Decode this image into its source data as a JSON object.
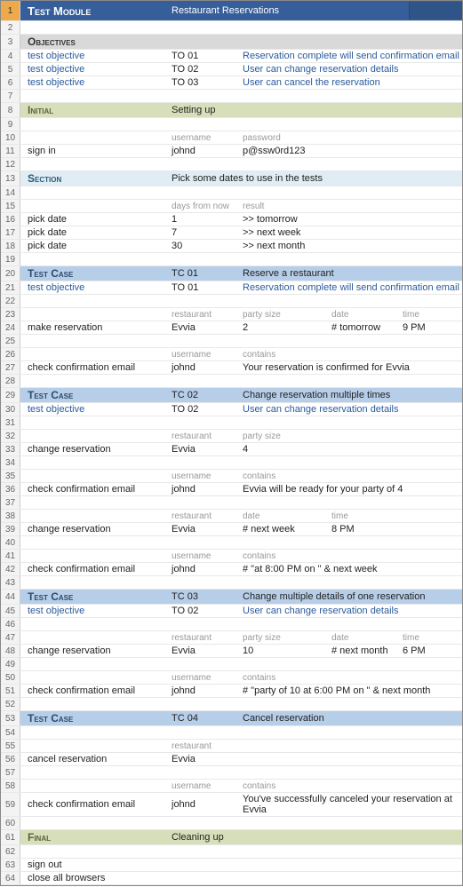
{
  "rows": [
    {
      "n": 1,
      "sel": true,
      "cls": "module",
      "A": "Test Module",
      "B": "Restaurant Reservations"
    },
    {
      "n": 2
    },
    {
      "n": 3,
      "cls": "band-grey",
      "A": "Objectives"
    },
    {
      "n": 4,
      "A": "test objective",
      "Acls": "link",
      "B": "TO 01",
      "C": "Reservation complete will send confirmation email",
      "Ccls": "link",
      "Cspan": 3
    },
    {
      "n": 5,
      "A": "test objective",
      "Acls": "link",
      "B": "TO 02",
      "C": "User can change reservation details",
      "Ccls": "link",
      "Cspan": 3
    },
    {
      "n": 6,
      "A": "test objective",
      "Acls": "link",
      "B": "TO 03",
      "C": "User can cancel the reservation",
      "Ccls": "link",
      "Cspan": 3
    },
    {
      "n": 7
    },
    {
      "n": 8,
      "cls": "band-olive",
      "A": "Initial",
      "B": "Setting up"
    },
    {
      "n": 9
    },
    {
      "n": 10,
      "B": "username",
      "Bcls": "hdr",
      "C": "password",
      "Ccls": "hdr"
    },
    {
      "n": 11,
      "A": "sign in",
      "B": "johnd",
      "C": "p@ssw0rd123"
    },
    {
      "n": 12
    },
    {
      "n": 13,
      "cls": "band-lightblue",
      "A": "Section",
      "B": "Pick some dates to use in the tests",
      "Bspan": 4
    },
    {
      "n": 14
    },
    {
      "n": 15,
      "B": "days from now",
      "Bcls": "hdr",
      "C": "result",
      "Ccls": "hdr"
    },
    {
      "n": 16,
      "A": "pick date",
      "B": "1",
      "C": ">> tomorrow"
    },
    {
      "n": 17,
      "A": "pick date",
      "B": "7",
      "C": ">> next week"
    },
    {
      "n": 18,
      "A": "pick date",
      "B": "30",
      "C": ">> next month"
    },
    {
      "n": 19
    },
    {
      "n": 20,
      "cls": "band-blue",
      "A": "Test Case",
      "B": "TC 01",
      "C": "Reserve a restaurant",
      "Cspan": 3
    },
    {
      "n": 21,
      "A": "test objective",
      "Acls": "link",
      "B": "TO 01",
      "C": "Reservation complete will send confirmation email",
      "Ccls": "link",
      "Cspan": 3
    },
    {
      "n": 22
    },
    {
      "n": 23,
      "B": "restaurant",
      "Bcls": "hdr",
      "C": "party size",
      "Ccls": "hdr",
      "D": "date",
      "Dcls": "hdr",
      "E": "time",
      "Ecls": "hdr"
    },
    {
      "n": 24,
      "A": "make reservation",
      "B": "Evvia",
      "C": "2",
      "D": "# tomorrow",
      "E": "9 PM"
    },
    {
      "n": 25
    },
    {
      "n": 26,
      "B": "username",
      "Bcls": "hdr",
      "C": "contains",
      "Ccls": "hdr"
    },
    {
      "n": 27,
      "A": "check confirmation email",
      "B": "johnd",
      "C": "Your reservation is confirmed for Evvia",
      "Cspan": 3
    },
    {
      "n": 28
    },
    {
      "n": 29,
      "cls": "band-blue",
      "A": "Test Case",
      "B": "TC 02",
      "C": "Change reservation multiple times",
      "Cspan": 3
    },
    {
      "n": 30,
      "A": "test objective",
      "Acls": "link",
      "B": "TO 02",
      "C": "User can change reservation details",
      "Ccls": "link",
      "Cspan": 3
    },
    {
      "n": 31
    },
    {
      "n": 32,
      "B": "restaurant",
      "Bcls": "hdr",
      "C": "party size",
      "Ccls": "hdr"
    },
    {
      "n": 33,
      "A": "change reservation",
      "B": "Evvia",
      "C": "4"
    },
    {
      "n": 34
    },
    {
      "n": 35,
      "B": "username",
      "Bcls": "hdr",
      "C": "contains",
      "Ccls": "hdr"
    },
    {
      "n": 36,
      "A": "check confirmation email",
      "B": "johnd",
      "C": "Evvia will be ready for your party of 4",
      "Cspan": 3
    },
    {
      "n": 37
    },
    {
      "n": 38,
      "B": "restaurant",
      "Bcls": "hdr",
      "C": "date",
      "Ccls": "hdr",
      "D": "time",
      "Dcls": "hdr"
    },
    {
      "n": 39,
      "A": "change reservation",
      "B": "Evvia",
      "C": "# next week",
      "D": "8 PM"
    },
    {
      "n": 40
    },
    {
      "n": 41,
      "B": "username",
      "Bcls": "hdr",
      "C": "contains",
      "Ccls": "hdr"
    },
    {
      "n": 42,
      "A": "check confirmation email",
      "B": "johnd",
      "C": "# \"at 8:00 PM on \" & next week",
      "Cspan": 3
    },
    {
      "n": 43
    },
    {
      "n": 44,
      "cls": "band-blue",
      "A": "Test Case",
      "B": "TC 03",
      "C": "Change multiple details of one reservation",
      "Cspan": 3
    },
    {
      "n": 45,
      "A": "test objective",
      "Acls": "link",
      "B": "TO 02",
      "C": "User can change reservation details",
      "Ccls": "link",
      "Cspan": 3
    },
    {
      "n": 46
    },
    {
      "n": 47,
      "B": "restaurant",
      "Bcls": "hdr",
      "C": "party size",
      "Ccls": "hdr",
      "D": "date",
      "Dcls": "hdr",
      "E": "time",
      "Ecls": "hdr"
    },
    {
      "n": 48,
      "A": "change reservation",
      "B": "Evvia",
      "C": "10",
      "D": "# next month",
      "E": "6 PM"
    },
    {
      "n": 49
    },
    {
      "n": 50,
      "B": "username",
      "Bcls": "hdr",
      "C": "contains",
      "Ccls": "hdr"
    },
    {
      "n": 51,
      "A": "check confirmation email",
      "B": "johnd",
      "C": "# \"party of 10 at 6:00 PM on \" & next month",
      "Cspan": 3
    },
    {
      "n": 52
    },
    {
      "n": 53,
      "cls": "band-blue",
      "A": "Test Case",
      "B": "TC 04",
      "C": "Cancel reservation",
      "Cspan": 3
    },
    {
      "n": 54
    },
    {
      "n": 55,
      "B": "restaurant",
      "Bcls": "hdr"
    },
    {
      "n": 56,
      "A": "cancel reservation",
      "B": "Evvia"
    },
    {
      "n": 57
    },
    {
      "n": 58,
      "B": "username",
      "Bcls": "hdr",
      "C": "contains",
      "Ccls": "hdr"
    },
    {
      "n": 59,
      "A": "check confirmation email",
      "B": "johnd",
      "C": "You've successfully canceled your reservation at Evvia",
      "Cspan": 3
    },
    {
      "n": 60
    },
    {
      "n": 61,
      "cls": "band-olive",
      "A": "Final",
      "B": "Cleaning up"
    },
    {
      "n": 62
    },
    {
      "n": 63,
      "A": "sign out"
    },
    {
      "n": 64,
      "A": "close all browsers"
    }
  ]
}
